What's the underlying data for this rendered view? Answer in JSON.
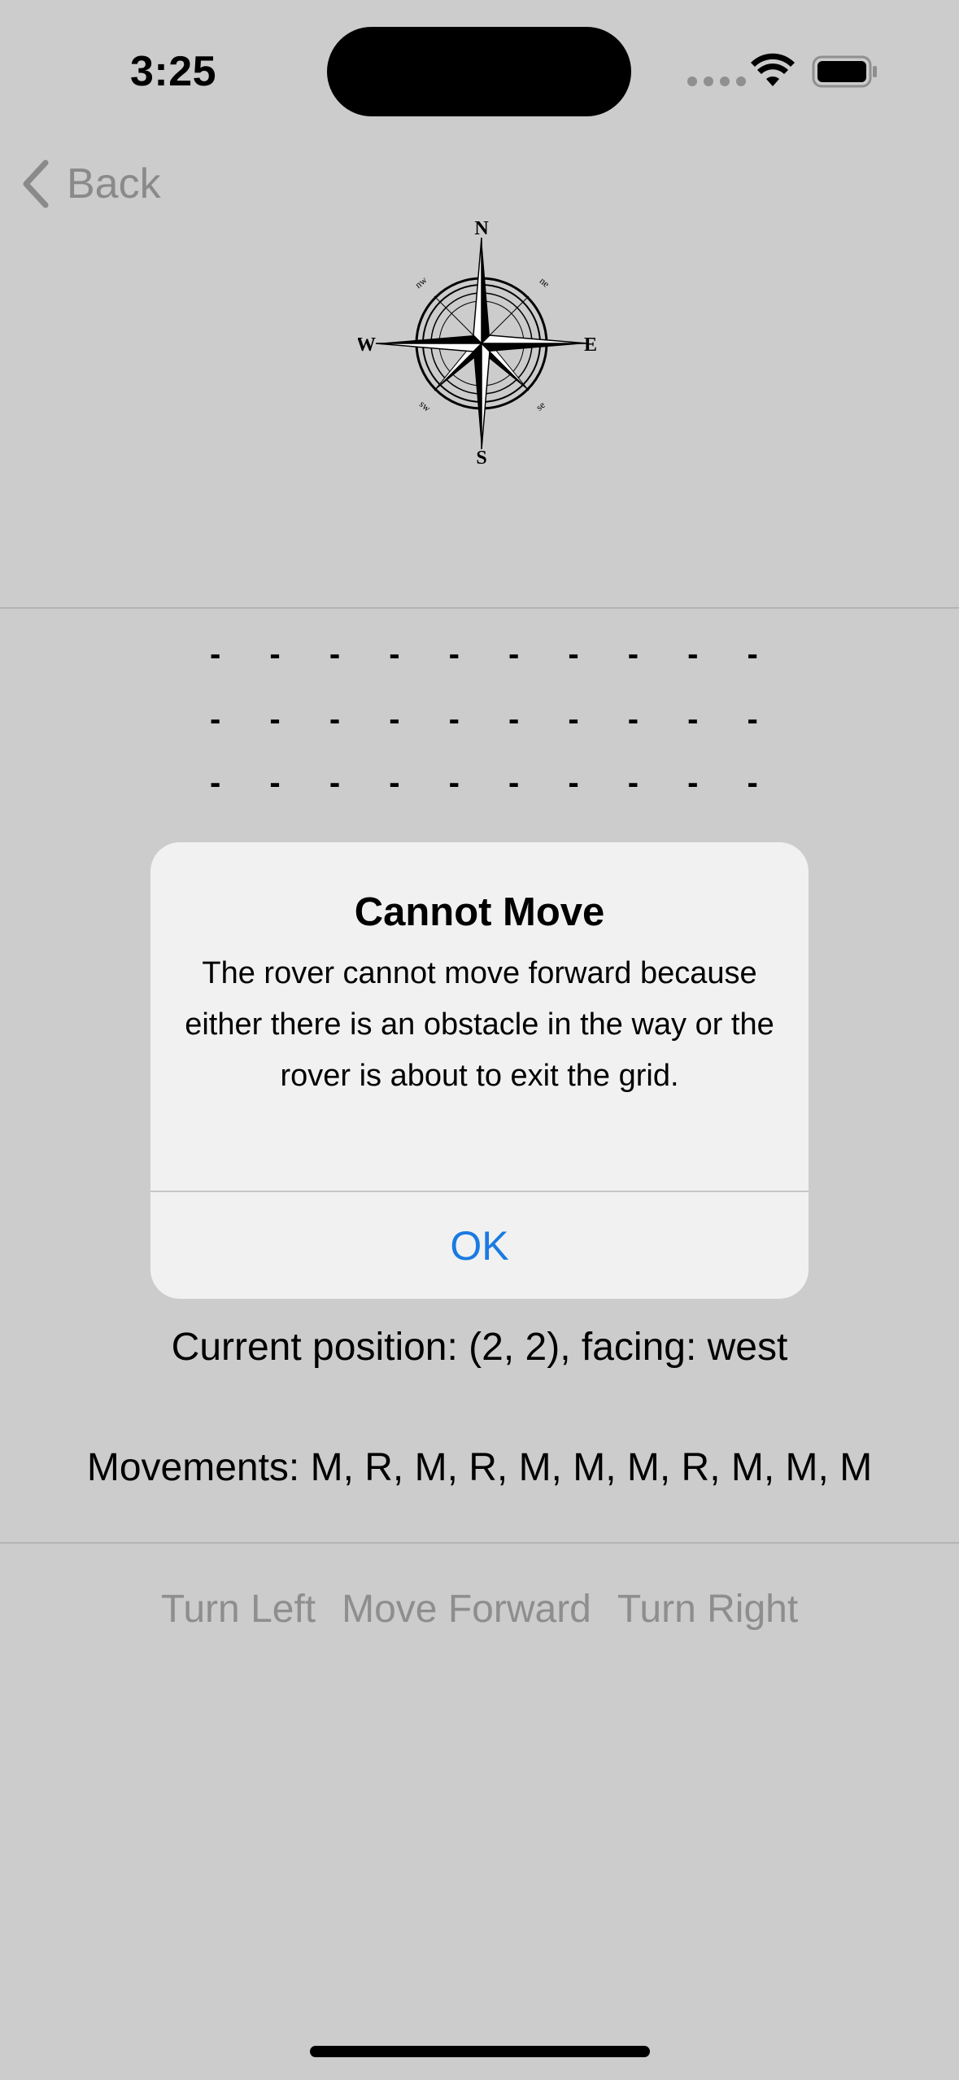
{
  "status_bar": {
    "time": "3:25"
  },
  "nav": {
    "back_label": "Back"
  },
  "compass": {
    "n": "N",
    "s": "S",
    "e": "E",
    "w": "W",
    "ne": "ne",
    "nw": "nw",
    "se": "se",
    "sw": "sw"
  },
  "grid": {
    "rows": [
      [
        "-",
        "-",
        "-",
        "-",
        "-",
        "-",
        "-",
        "-",
        "-",
        "-"
      ],
      [
        "-",
        "-",
        "-",
        "-",
        "-",
        "-",
        "-",
        "-",
        "-",
        "-"
      ],
      [
        "-",
        "-",
        "-",
        "-",
        "-",
        "-",
        "-",
        "-",
        "-",
        "-"
      ]
    ]
  },
  "alert": {
    "title": "Cannot Move",
    "message": "The rover cannot move forward because either there is an obstacle in the way or the rover is about to exit the grid.",
    "ok_label": "OK"
  },
  "info": {
    "position": "Current position: (2, 2), facing: west",
    "movements": "Movements: M, R, M, R, M, M, M, R, M, M, M"
  },
  "controls": {
    "turn_left": "Turn Left",
    "move_forward": "Move Forward",
    "turn_right": "Turn Right"
  }
}
